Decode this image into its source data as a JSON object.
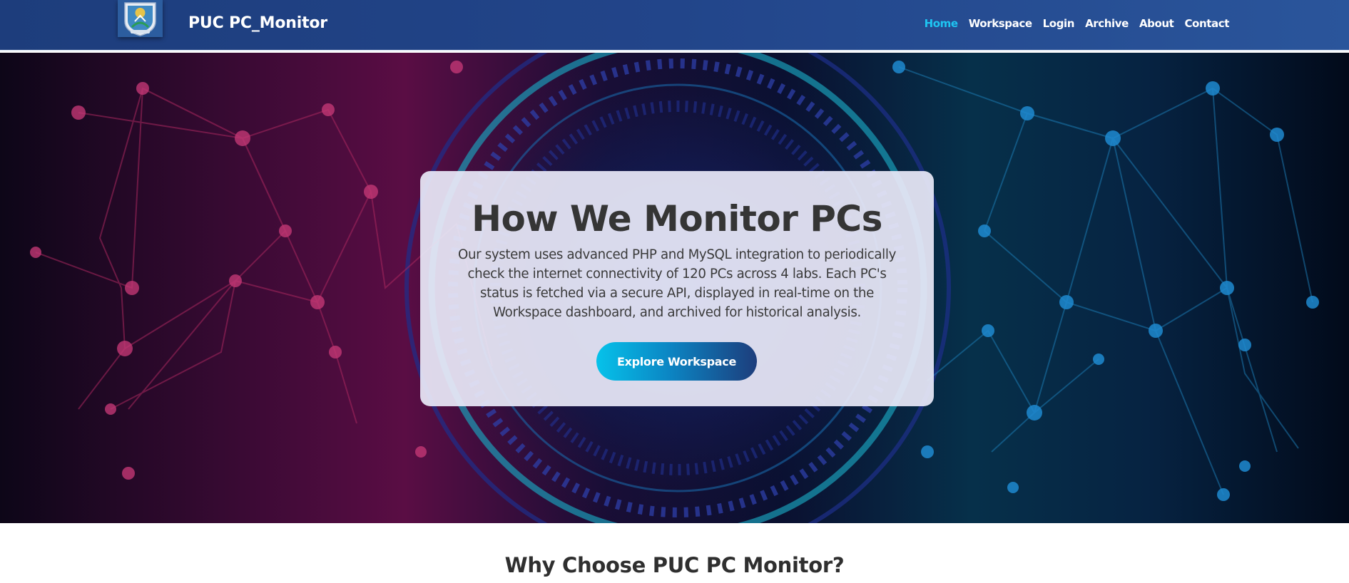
{
  "navbar": {
    "brand": "PUC PC_Monitor",
    "logo_icon": "university-crest-logo",
    "links": [
      {
        "label": "Home",
        "active": true
      },
      {
        "label": "Workspace",
        "active": false
      },
      {
        "label": "Login",
        "active": false
      },
      {
        "label": "Archive",
        "active": false
      },
      {
        "label": "About",
        "active": false
      },
      {
        "label": "Contact",
        "active": false
      }
    ]
  },
  "hero": {
    "title": "How We Monitor PCs",
    "description": "Our system uses advanced PHP and MySQL integration to periodically check the internet connectivity of 120 PCs across 4 labs. Each PC's status is fetched via a secure API, displayed in real-time on the Workspace dashboard, and archived for historical analysis.",
    "cta_label": "Explore Workspace"
  },
  "features": {
    "heading": "Why Choose PUC PC Monitor?"
  },
  "colors": {
    "navbar": "#22458a",
    "active_link": "#1ec5f2",
    "button_start": "#06c2ea",
    "button_end": "#1d3d7c",
    "card_bg": "#e8e8f8"
  }
}
